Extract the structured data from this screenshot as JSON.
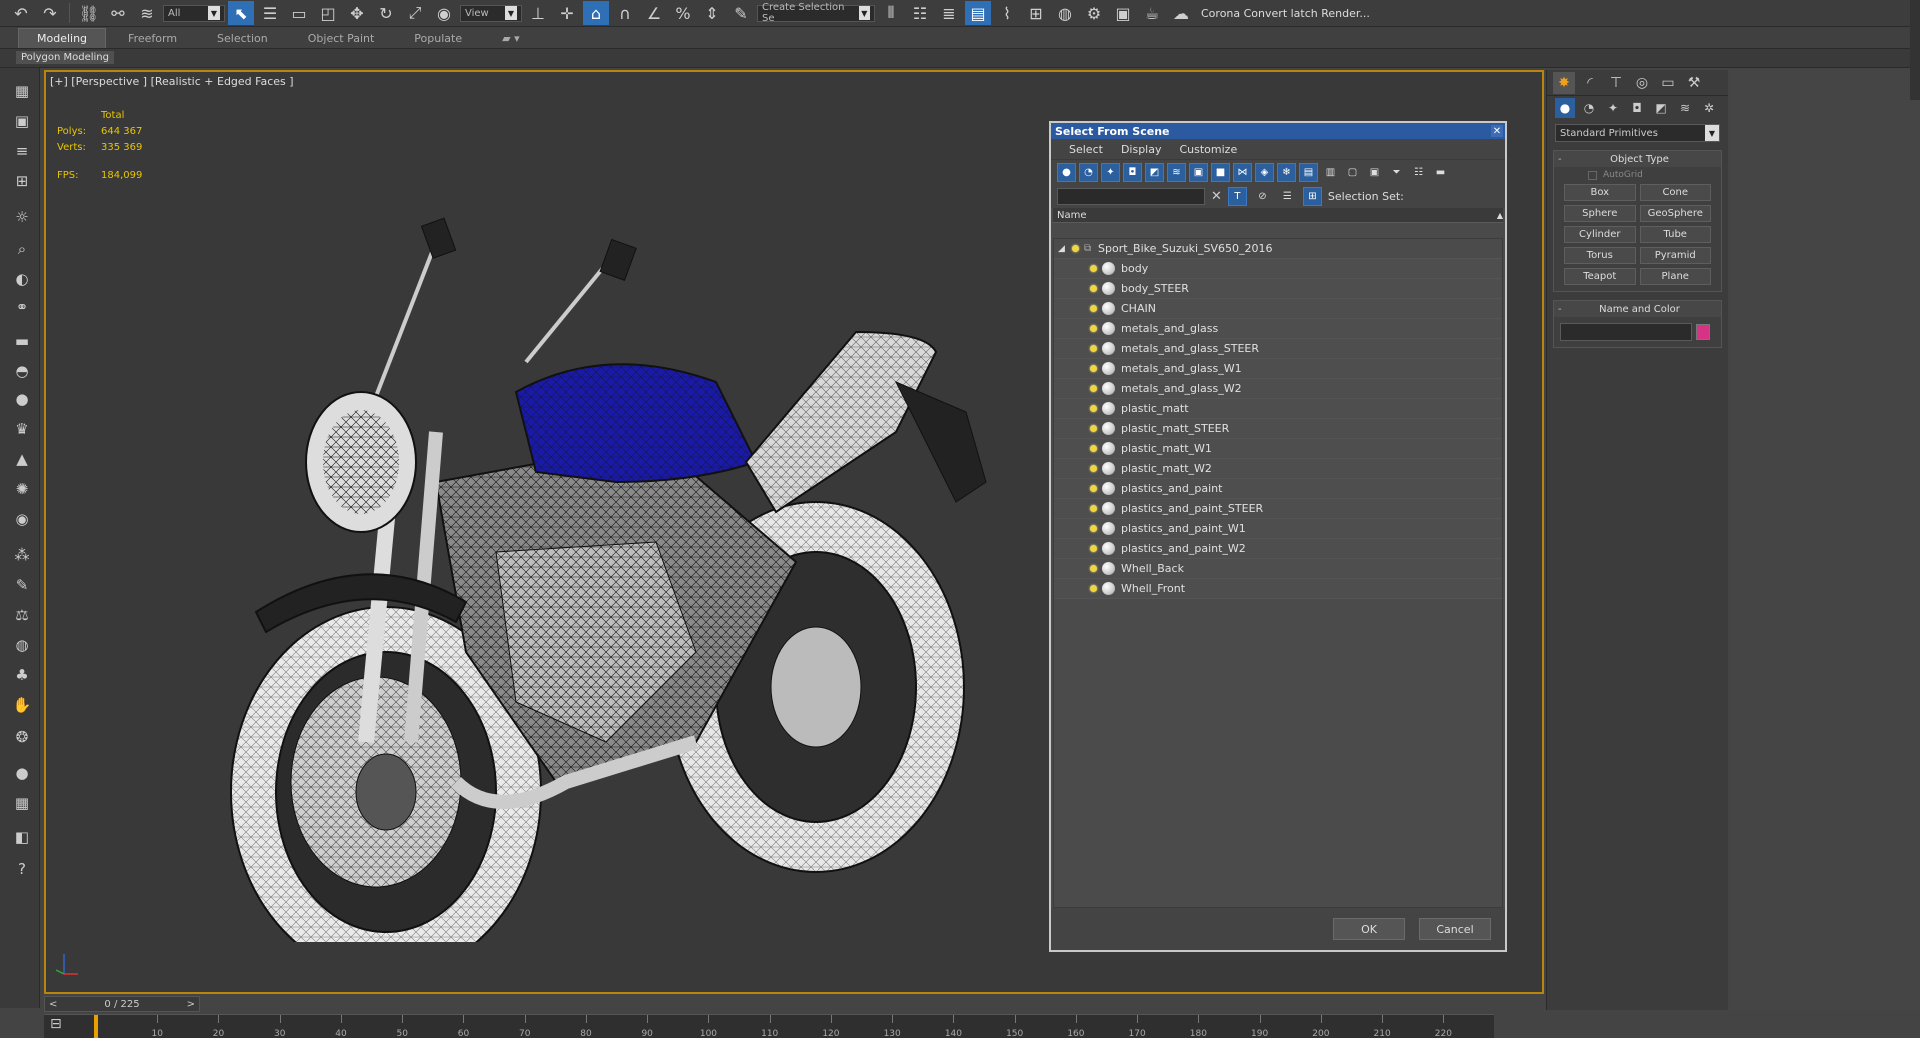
{
  "toolbar": {
    "filter_value": "All",
    "view_value": "View",
    "selection_set_placeholder": "Create Selection Se",
    "render_label": "Corona Convert latch Render...",
    "icons": [
      "undo-icon",
      "redo-icon",
      "link-icon",
      "unlink-icon",
      "bind-space-warp-icon",
      "select-object-icon",
      "select-by-name-icon",
      "rect-select-icon",
      "window-crossing-icon",
      "move-icon",
      "rotate-icon",
      "scale-icon",
      "place-icon",
      "pivot-icon",
      "manipulate-icon",
      "snap-3d-icon",
      "angle-snap-icon",
      "percent-snap-icon",
      "spinner-snap-icon",
      "edit-named-selection-icon",
      "mirror-icon",
      "align-icon",
      "layer-explorer-icon",
      "toggle-ribbon-icon",
      "curve-editor-icon",
      "schematic-view-icon",
      "material-editor-icon",
      "render-setup-icon",
      "rendered-frame-icon",
      "render-icon"
    ]
  },
  "ribbon": {
    "tabs": [
      "Modeling",
      "Freeform",
      "Selection",
      "Object Paint",
      "Populate"
    ],
    "active_tab": "Modeling",
    "sub_label": "Polygon Modeling"
  },
  "viewport": {
    "label": "[+] [Perspective ] [Realistic + Edged Faces ]",
    "stats_header": "Total",
    "polys_label": "Polys:",
    "polys_value": "644 367",
    "verts_label": "Verts:",
    "verts_value": "335 369",
    "fps_label": "FPS:",
    "fps_value": "184,099"
  },
  "dialog": {
    "title": "Select From Scene",
    "menu": [
      "Select",
      "Display",
      "Customize"
    ],
    "selection_set_label": "Selection Set:",
    "column_name": "Name",
    "root": "Sport_Bike_Suzuki_SV650_2016",
    "items": [
      "body",
      "body_STEER",
      "CHAIN",
      "metals_and_glass",
      "metals_and_glass_STEER",
      "metals_and_glass_W1",
      "metals_and_glass_W2",
      "plastic_matt",
      "plastic_matt_STEER",
      "plastic_matt_W1",
      "plastic_matt_W2",
      "plastics_and_paint",
      "plastics_and_paint_STEER",
      "plastics_and_paint_W1",
      "plastics_and_paint_W2",
      "Whell_Back",
      "Whell_Front"
    ],
    "ok_label": "OK",
    "cancel_label": "Cancel"
  },
  "command_panel": {
    "dropdown_value": "Standard Primitives",
    "object_type_title": "Object Type",
    "autogrid_label": "AutoGrid",
    "primitives": [
      "Box",
      "Cone",
      "Sphere",
      "GeoSphere",
      "Cylinder",
      "Tube",
      "Torus",
      "Pyramid",
      "Teapot",
      "Plane"
    ],
    "name_color_title": "Name and Color",
    "object_color": "#d63384"
  },
  "timeline": {
    "frame_display": "0 / 225",
    "ticks": [
      "10",
      "20",
      "30",
      "40",
      "50",
      "60",
      "70",
      "80",
      "90",
      "100",
      "110",
      "120",
      "130",
      "140",
      "150",
      "160",
      "170",
      "180",
      "190",
      "200",
      "210",
      "220"
    ]
  },
  "colors": {
    "accent_blue": "#2b5f9e",
    "viewport_border": "#b8860b",
    "stats_yellow": "#e8c500",
    "tank_blue": "#1a1aa8"
  }
}
